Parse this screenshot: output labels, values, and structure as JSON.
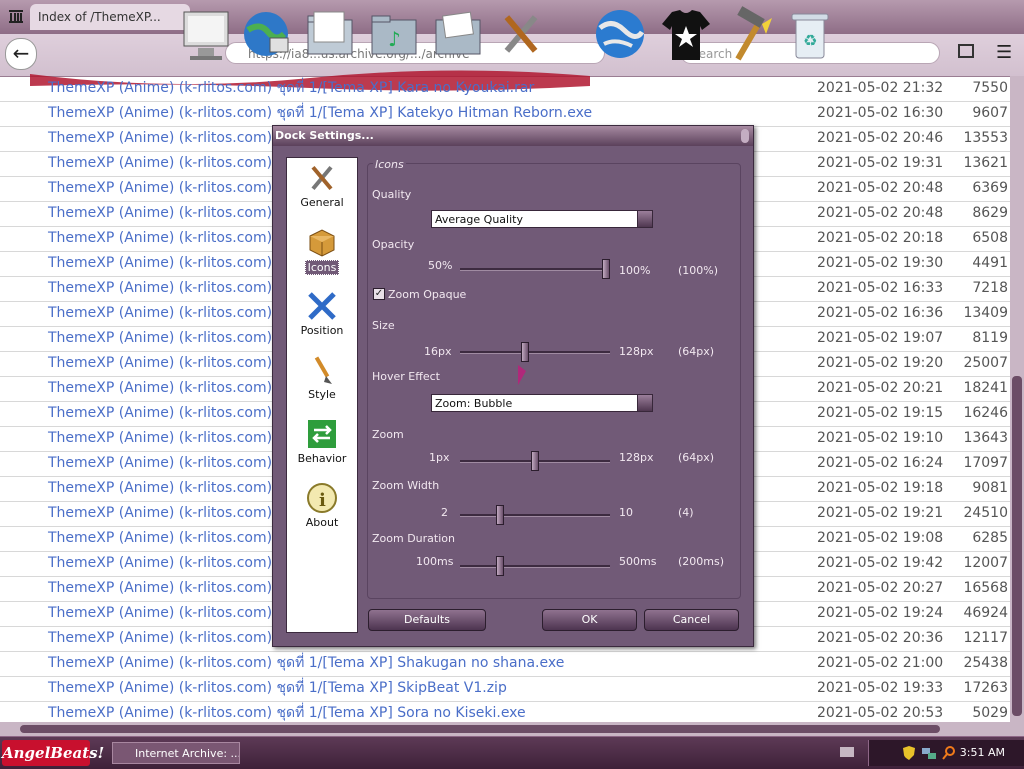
{
  "browser": {
    "tab_title": "Index of /ThemeXP...",
    "url": "https://ia8...us.archive.org/.../archive",
    "search_placeholder": "Search"
  },
  "dock": {
    "items": [
      "monitor-icon",
      "globe-network-icon",
      "folder-icon",
      "folder-music-icon",
      "folder-pictures-icon",
      "tools-icon",
      "globe-icon",
      "tshirt-icon",
      "hammer-icon",
      "recycle-bin-icon"
    ]
  },
  "list": {
    "rows": [
      {
        "name": "ThemeXP (Anime) (k-rlitos.com) ชุดที่ 1/[Tema XP] Kara no Kyoukai.rar",
        "date": "2021-05-02 21:32",
        "size": "7550"
      },
      {
        "name": "ThemeXP (Anime) (k-rlitos.com) ชุดที่ 1/[Tema XP] Katekyo Hitman Reborn.exe",
        "date": "2021-05-02 16:30",
        "size": "9607"
      },
      {
        "name": "ThemeXP (Anime) (k-rlitos.com) ชุด",
        "date": "2021-05-02 20:46",
        "size": "13553"
      },
      {
        "name": "ThemeXP (Anime) (k-rlitos.com) ชุด",
        "date": "2021-05-02 19:31",
        "size": "13621"
      },
      {
        "name": "ThemeXP (Anime) (k-rlitos.com) ชุด",
        "date": "2021-05-02 20:48",
        "size": "6369"
      },
      {
        "name": "ThemeXP (Anime) (k-rlitos.com) ชุด",
        "date": "2021-05-02 20:48",
        "size": "8629"
      },
      {
        "name": "ThemeXP (Anime) (k-rlitos.com) ชุด",
        "date": "2021-05-02 20:18",
        "size": "6508"
      },
      {
        "name": "ThemeXP (Anime) (k-rlitos.com) ชุด",
        "date": "2021-05-02 19:30",
        "size": "4491"
      },
      {
        "name": "ThemeXP (Anime) (k-rlitos.com) ชุด",
        "date": "2021-05-02 16:33",
        "size": "7218"
      },
      {
        "name": "ThemeXP (Anime) (k-rlitos.com) ชุด",
        "date": "2021-05-02 16:36",
        "size": "13409"
      },
      {
        "name": "ThemeXP (Anime) (k-rlitos.com) ชุด",
        "date": "2021-05-02 19:07",
        "size": "8119"
      },
      {
        "name": "ThemeXP (Anime) (k-rlitos.com) ชุด",
        "date": "2021-05-02 19:20",
        "size": "25007"
      },
      {
        "name": "ThemeXP (Anime) (k-rlitos.com) ชุด",
        "date": "2021-05-02 20:21",
        "size": "18241"
      },
      {
        "name": "ThemeXP (Anime) (k-rlitos.com) ชุด",
        "date": "2021-05-02 19:15",
        "size": "16246"
      },
      {
        "name": "ThemeXP (Anime) (k-rlitos.com) ชุด",
        "date": "2021-05-02 19:10",
        "size": "13643"
      },
      {
        "name": "ThemeXP (Anime) (k-rlitos.com) ชุด",
        "date": "2021-05-02 16:24",
        "size": "17097"
      },
      {
        "name": "ThemeXP (Anime) (k-rlitos.com) ชุด",
        "date": "2021-05-02 19:18",
        "size": "9081"
      },
      {
        "name": "ThemeXP (Anime) (k-rlitos.com) ชุด",
        "date": "2021-05-02 19:21",
        "size": "24510"
      },
      {
        "name": "ThemeXP (Anime) (k-rlitos.com) ชุด",
        "date": "2021-05-02 19:08",
        "size": "6285"
      },
      {
        "name": "ThemeXP (Anime) (k-rlitos.com) ชุด",
        "date": "2021-05-02 19:42",
        "size": "12007"
      },
      {
        "name": "ThemeXP (Anime) (k-rlitos.com) ชุด",
        "date": "2021-05-02 20:27",
        "size": "16568"
      },
      {
        "name": "ThemeXP (Anime) (k-rlitos.com) ชุด",
        "date": "2021-05-02 19:24",
        "size": "46924"
      },
      {
        "name": "ThemeXP (Anime) (k-rlitos.com) ชุด",
        "date": "2021-05-02 20:36",
        "size": "12117"
      },
      {
        "name": "ThemeXP (Anime) (k-rlitos.com) ชุดที่ 1/[Tema XP] Shakugan no shana.exe",
        "date": "2021-05-02 21:00",
        "size": "25438"
      },
      {
        "name": "ThemeXP (Anime) (k-rlitos.com) ชุดที่ 1/[Tema XP] SkipBeat V1.zip",
        "date": "2021-05-02 19:33",
        "size": "17263"
      },
      {
        "name": "ThemeXP (Anime) (k-rlitos.com) ชุดที่ 1/[Tema XP] Sora no Kiseki.exe",
        "date": "2021-05-02 20:53",
        "size": "5029"
      }
    ]
  },
  "dialog": {
    "title": "Dock Settings...",
    "nav": [
      "General",
      "Icons",
      "Position",
      "Style",
      "Behavior",
      "About"
    ],
    "selected_nav": "Icons",
    "group_title": "Icons",
    "quality_label": "Quality",
    "quality_value": "Average Quality",
    "opacity_label": "Opacity",
    "opacity_min": "50%",
    "opacity_max": "100%",
    "opacity_current": "(100%)",
    "opacity_fraction": 1.0,
    "zoom_opaque_label": "Zoom Opaque",
    "zoom_opaque_checked": true,
    "size_label": "Size",
    "size_min": "16px",
    "size_max": "128px",
    "size_current": "(64px)",
    "size_fraction": 0.43,
    "hover_label": "Hover Effect",
    "hover_value": "Zoom: Bubble",
    "zoom_label": "Zoom",
    "zoom_min": "1px",
    "zoom_max": "128px",
    "zoom_current": "(64px)",
    "zoom_fraction": 0.5,
    "zoom_width_label": "Zoom Width",
    "zoom_width_min": "2",
    "zoom_width_max": "10",
    "zoom_width_current": "(4)",
    "zoom_width_fraction": 0.25,
    "zoom_duration_label": "Zoom Duration",
    "zoom_duration_min": "100ms",
    "zoom_duration_max": "500ms",
    "zoom_duration_current": "(200ms)",
    "zoom_duration_fraction": 0.25,
    "defaults_label": "Defaults",
    "ok_label": "OK",
    "cancel_label": "Cancel"
  },
  "taskbar": {
    "start_label": "AngelBeats!",
    "task_label": "Internet Archive: ...",
    "clock": "3:51 AM"
  },
  "colors": {
    "link": "#4a6ec8",
    "dialog_bg": "#715a77",
    "taskbar": "#4a2a44",
    "accent_red": "#c8102e"
  }
}
